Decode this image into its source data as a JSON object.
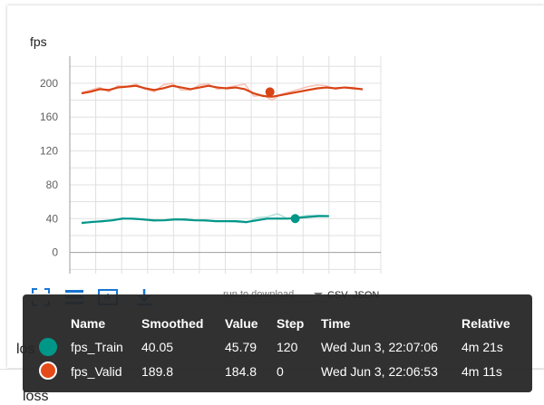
{
  "card": {
    "title": "fps"
  },
  "chart_data": {
    "type": "line",
    "title": "fps",
    "xlabel": "",
    "ylabel": "",
    "ylim": [
      -25,
      232
    ],
    "y_ticks": [
      0,
      40,
      80,
      120,
      160,
      200
    ],
    "x": [
      0,
      10,
      20,
      30,
      40,
      50,
      60,
      70,
      80,
      90,
      100,
      110,
      120,
      130,
      140,
      150,
      160
    ],
    "series": [
      {
        "name": "fps_Valid",
        "color": "#d84315",
        "raw_color": "#f8bfb0",
        "smoothed": [
          188,
          190,
          193,
          192,
          195,
          196,
          197,
          194,
          192,
          194,
          197,
          195,
          193,
          195,
          197,
          195,
          194,
          195,
          193,
          188,
          185,
          184,
          186,
          188,
          190,
          192,
          194,
          195,
          194,
          195,
          194,
          193
        ],
        "values": [
          189,
          192,
          195,
          190,
          197,
          196,
          199,
          193,
          190,
          198,
          200,
          192,
          192,
          198,
          199,
          193,
          195,
          197,
          199,
          184.8,
          186,
          180,
          187,
          190,
          193,
          196,
          198,
          197,
          193,
          195,
          195,
          192
        ],
        "highlight": {
          "x": 70,
          "y": 189.8
        }
      },
      {
        "name": "fps_Train",
        "color": "#009688",
        "raw_color": "#b2dfdb",
        "smoothed": [
          35,
          36,
          37,
          38,
          40,
          40,
          39,
          38,
          38,
          39,
          39,
          38,
          38,
          37,
          37,
          37,
          36,
          38,
          40,
          40.05,
          40,
          41,
          42,
          43,
          43
        ],
        "values": [
          34,
          37,
          36,
          39,
          41,
          39,
          39,
          37,
          38,
          40,
          38,
          38,
          37,
          37,
          37,
          36,
          35,
          41,
          42,
          45.79,
          40,
          42,
          44,
          44,
          43
        ],
        "highlight": {
          "x": 70,
          "y": 40.05
        }
      }
    ]
  },
  "toolbar": {
    "download_placeholder": "run to download",
    "csv": "CSV",
    "json": "JSON"
  },
  "tooltip": {
    "headers": {
      "name": "Name",
      "smoothed": "Smoothed",
      "value": "Value",
      "step": "Step",
      "time": "Time",
      "relative": "Relative"
    },
    "rows": [
      {
        "name": "fps_Train",
        "smoothed": "40.05",
        "value": "45.79",
        "step": "120",
        "time": "Wed Jun 3, 22:07:06",
        "relative": "4m 21s",
        "color": "#009688"
      },
      {
        "name": "fps_Valid",
        "smoothed": "189.8",
        "value": "184.8",
        "step": "0",
        "time": "Wed Jun 3, 22:06:53",
        "relative": "4m 11s",
        "color": "#e64a19"
      }
    ]
  },
  "below": {
    "partial_label_1": "los",
    "partial_label_2": "loss"
  }
}
